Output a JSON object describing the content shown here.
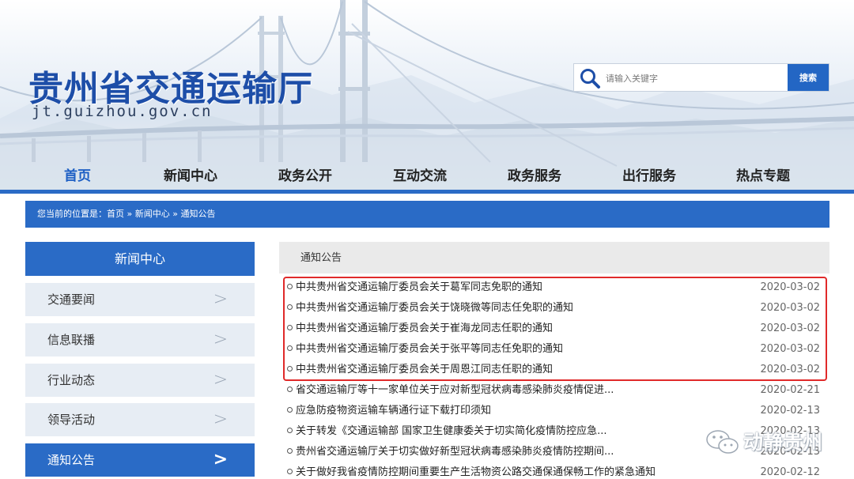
{
  "site": {
    "name_cn": "贵州省交通运输厅",
    "domain": "jt.guizhou.gov.cn"
  },
  "search": {
    "placeholder": "请输入关键字",
    "button_label": "搜索"
  },
  "nav": {
    "items": [
      {
        "label": "首页",
        "active": true
      },
      {
        "label": "新闻中心",
        "active": false
      },
      {
        "label": "政务公开",
        "active": false
      },
      {
        "label": "互动交流",
        "active": false
      },
      {
        "label": "政务服务",
        "active": false
      },
      {
        "label": "出行服务",
        "active": false
      },
      {
        "label": "热点专题",
        "active": false
      }
    ]
  },
  "breadcrumb": {
    "text": "您当前的位置是：首页 » 新闻中心 » 通知公告"
  },
  "sidebar": {
    "title": "新闻中心",
    "chevron": ">",
    "items": [
      {
        "label": "交通要闻",
        "active": false
      },
      {
        "label": "信息联播",
        "active": false
      },
      {
        "label": "行业动态",
        "active": false
      },
      {
        "label": "领导活动",
        "active": false
      },
      {
        "label": "通知公告",
        "active": true
      }
    ]
  },
  "main": {
    "heading": "通知公告",
    "rows": [
      {
        "title": "中共贵州省交通运输厅委员会关于葛军同志免职的通知",
        "date": "2020-03-02"
      },
      {
        "title": "中共贵州省交通运输厅委员会关于饶晓微等同志任免职的通知",
        "date": "2020-03-02"
      },
      {
        "title": "中共贵州省交通运输厅委员会关于崔海龙同志任职的通知",
        "date": "2020-03-02"
      },
      {
        "title": "中共贵州省交通运输厅委员会关于张平等同志任免职的通知",
        "date": "2020-03-02"
      },
      {
        "title": "中共贵州省交通运输厅委员会关于周恩江同志任职的通知",
        "date": "2020-03-02"
      },
      {
        "title": "省交通运输厅等十一家单位关于应对新型冠状病毒感染肺炎疫情促进...",
        "date": "2020-02-21"
      },
      {
        "title": "应急防疫物资运输车辆通行证下载打印须知",
        "date": "2020-02-13"
      },
      {
        "title": "关于转发《交通运输部 国家卫生健康委关于切实简化疫情防控应急...",
        "date": "2020-02-13"
      },
      {
        "title": "贵州省交通运输厅关于切实做好新型冠状病毒感染肺炎疫情防控期间...",
        "date": "2020-02-13"
      },
      {
        "title": "关于做好我省疫情防控期间重要生产生活物资公路交通保通保畅工作的紧急通知",
        "date": "2020-02-12"
      }
    ]
  },
  "watermark": {
    "text": "动静贵州"
  },
  "colors": {
    "brand_blue": "#2a6bc6",
    "logo_blue": "#1d4ea8",
    "highlight_red": "#e02a2a",
    "sidebar_bg": "#e7edf4"
  }
}
